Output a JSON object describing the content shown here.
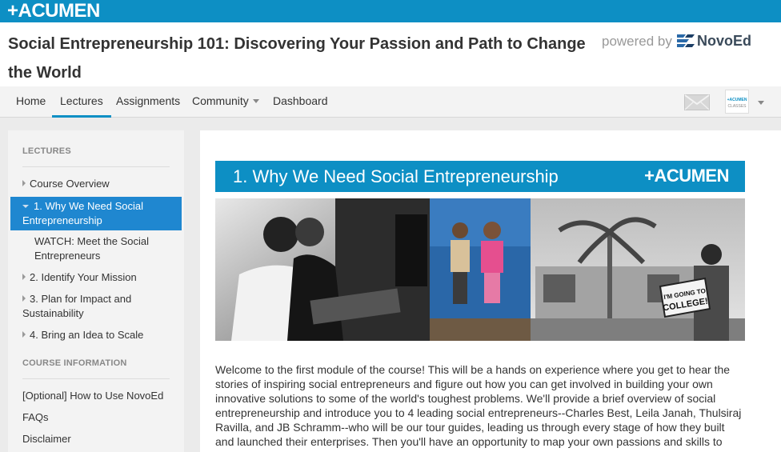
{
  "brand": {
    "logo": "+ACUMEN"
  },
  "header": {
    "course_title": "Social Entrepreneurship 101: Discovering Your Passion and Path to Change the World",
    "powered_by": "powered by",
    "platform_name": "NovoEd"
  },
  "nav": {
    "items": [
      {
        "label": "Home",
        "active": false
      },
      {
        "label": "Lectures",
        "active": true
      },
      {
        "label": "Assignments",
        "active": false
      },
      {
        "label": "Community",
        "active": false,
        "dropdown": true
      },
      {
        "label": "Dashboard",
        "active": false
      }
    ],
    "mail_icon": "envelope-icon",
    "avatar_text": "+ACUMEN\nCLASSES"
  },
  "sidebar": {
    "lectures_heading": "LECTURES",
    "lectures": [
      {
        "label": "Course Overview",
        "state": "collapsed"
      },
      {
        "label": "1. Why We Need Social Entrepreneurship",
        "state": "expanded-active"
      },
      {
        "label": "WATCH: Meet the Social Entrepreneurs",
        "state": "sub-item"
      },
      {
        "label": "2. Identify Your Mission",
        "state": "collapsed"
      },
      {
        "label": "3. Plan for Impact and Sustainability",
        "state": "collapsed"
      },
      {
        "label": "4. Bring an Idea to Scale",
        "state": "collapsed"
      }
    ],
    "info_heading": "COURSE INFORMATION",
    "info_links": [
      {
        "label": "[Optional] How to Use NovoEd"
      },
      {
        "label": "FAQs"
      },
      {
        "label": "Disclaimer"
      }
    ]
  },
  "main": {
    "lecture_title": "1. Why We Need Social Entrepreneurship",
    "banner_logo": "+ACUMEN",
    "photo_sign": "I'M GOING TO COLLEGE!",
    "intro_text": "Welcome to the first module of the course! This will be a hands on experience where you get to hear the stories of inspiring social entrepreneurs and figure out how you can get involved in building your own innovative solutions to some of the world's toughest problems. We'll provide a brief overview of social entrepreneurship and introduce you to 4 leading social entrepreneurs--Charles Best, Leila Janah, Thulsiraj Ravilla, and JB Schramm--who will be our tour guides, leading us through every stage of how they built and launched their enterprises. Then you'll have an opportunity to map your own passions and skills to"
  },
  "colors": {
    "brand_blue": "#0d8fc4",
    "active_blue": "#1f87d0"
  }
}
